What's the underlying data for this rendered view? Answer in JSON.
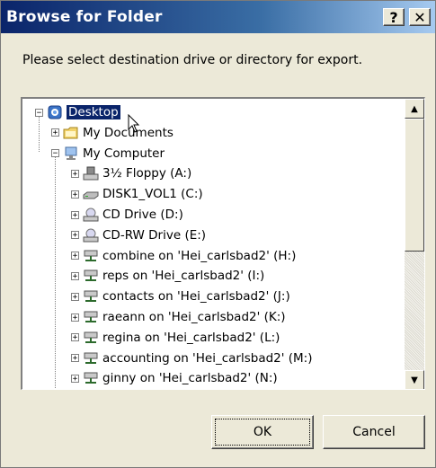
{
  "window": {
    "title": "Browse for Folder",
    "help_label": "?",
    "close_label": "✕"
  },
  "prompt": "Please select destination drive or directory for export.",
  "tree": {
    "items": [
      {
        "label": "Desktop",
        "icon": "desktop-icon",
        "expander": "−",
        "level": 0,
        "selected": true
      },
      {
        "label": "My Documents",
        "icon": "folder-icon",
        "expander": "+",
        "level": 1
      },
      {
        "label": "My Computer",
        "icon": "computer-icon",
        "expander": "−",
        "level": 1
      },
      {
        "label": "3½ Floppy (A:)",
        "icon": "floppy-drive-icon",
        "expander": "+",
        "level": 2
      },
      {
        "label": "DISK1_VOL1 (C:)",
        "icon": "hard-drive-icon",
        "expander": "+",
        "level": 2
      },
      {
        "label": "CD Drive (D:)",
        "icon": "cd-drive-icon",
        "expander": "+",
        "level": 2
      },
      {
        "label": "CD-RW Drive (E:)",
        "icon": "cd-drive-icon",
        "expander": "+",
        "level": 2
      },
      {
        "label": "combine on 'Hei_carlsbad2' (H:)",
        "icon": "network-drive-icon",
        "expander": "+",
        "level": 2
      },
      {
        "label": "reps on 'Hei_carlsbad2' (I:)",
        "icon": "network-drive-icon",
        "expander": "+",
        "level": 2
      },
      {
        "label": "contacts on 'Hei_carlsbad2' (J:)",
        "icon": "network-drive-icon",
        "expander": "+",
        "level": 2
      },
      {
        "label": "raeann on 'Hei_carlsbad2' (K:)",
        "icon": "network-drive-icon",
        "expander": "+",
        "level": 2
      },
      {
        "label": "regina on 'Hei_carlsbad2' (L:)",
        "icon": "network-drive-icon",
        "expander": "+",
        "level": 2
      },
      {
        "label": "accounting on 'Hei_carlsbad2' (M:)",
        "icon": "network-drive-icon",
        "expander": "+",
        "level": 2
      },
      {
        "label": "ginny on 'Hei_carlsbad2' (N:)",
        "icon": "network-drive-icon",
        "expander": "+",
        "level": 2
      }
    ]
  },
  "scrollbar": {
    "up_label": "▲",
    "down_label": "▼"
  },
  "buttons": {
    "ok_label": "OK",
    "cancel_label": "Cancel"
  },
  "colors": {
    "title_bar": "#0a246a",
    "selection": "#0a246a",
    "dialog_bg": "#ece9d8"
  }
}
